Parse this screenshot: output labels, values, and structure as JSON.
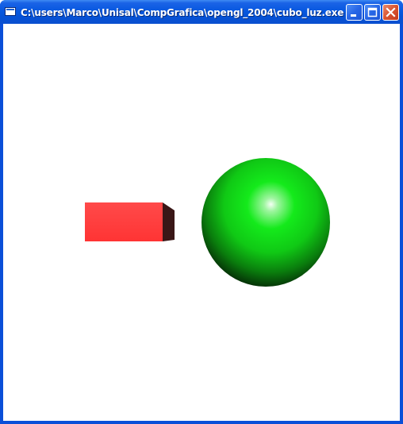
{
  "window": {
    "title": "C:\\users\\Marco\\Unisal\\CompGrafica\\opengl_2004\\cubo_luz.exe",
    "icons": {
      "app": "console-window-icon",
      "minimize": "minimize-icon",
      "maximize": "maximize-icon",
      "close": "close-icon"
    }
  },
  "scene": {
    "background_color": "#ffffff",
    "cube_color": "#ff3c3c",
    "sphere_color": "#13e61a"
  }
}
